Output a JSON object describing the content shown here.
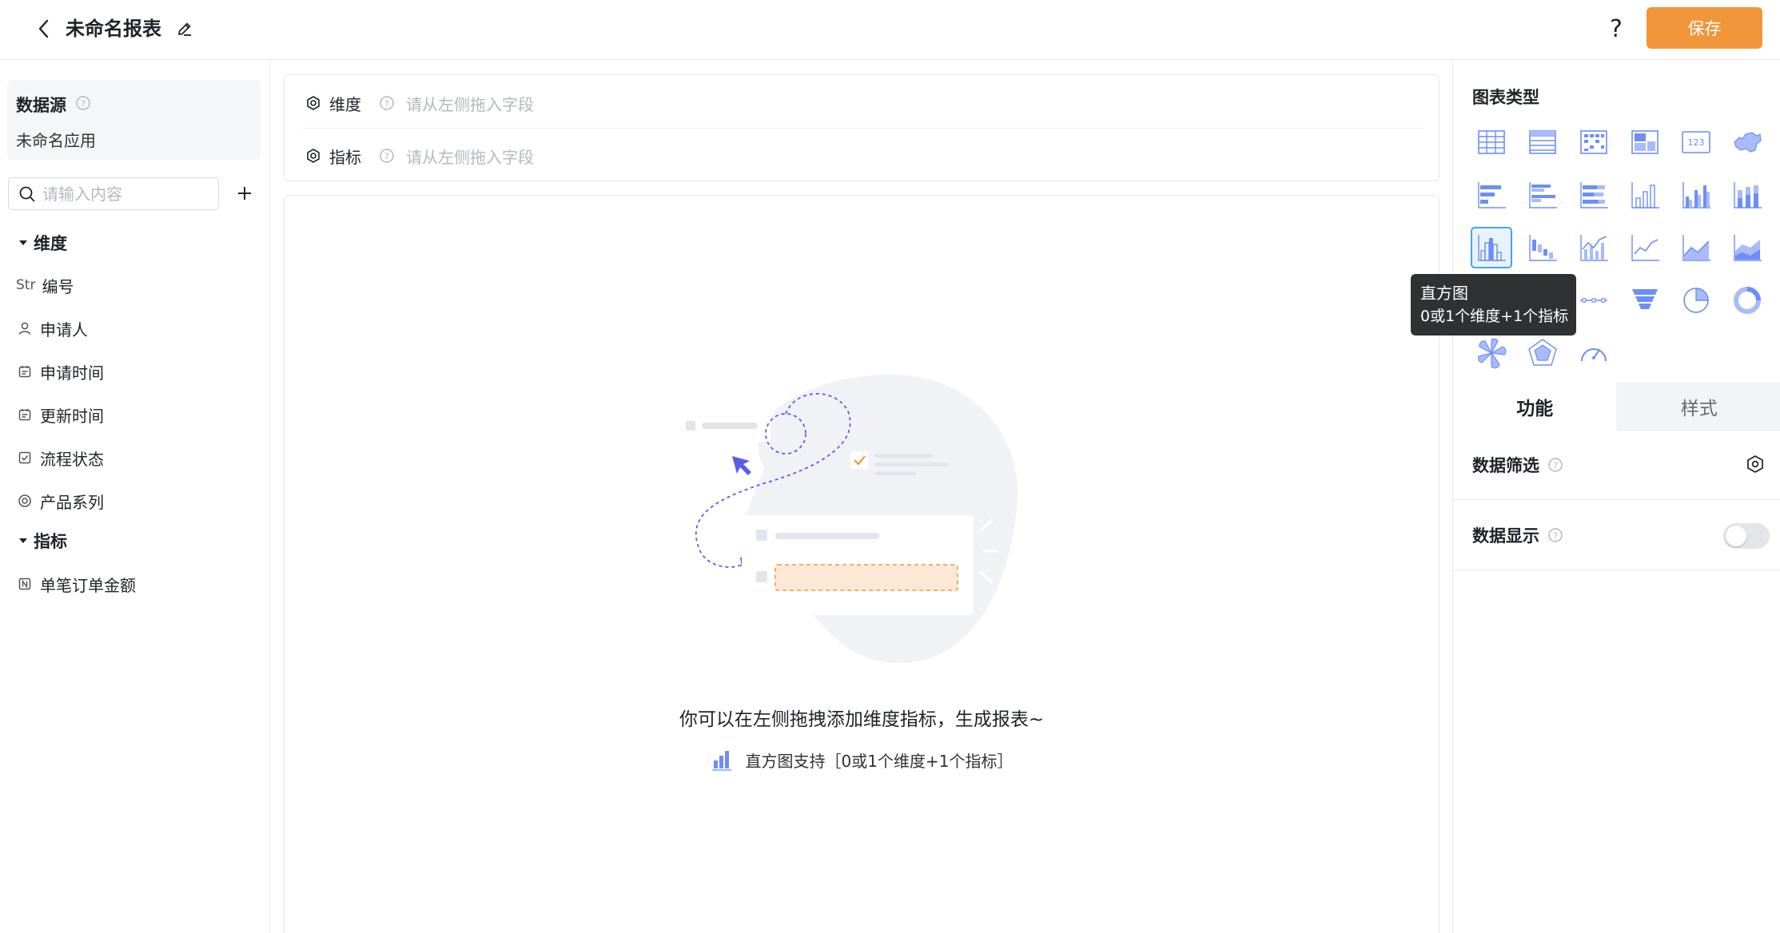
{
  "header": {
    "title": "未命名报表",
    "help": "?",
    "save_label": "保存"
  },
  "sidebar": {
    "datasource_title": "数据源",
    "datasource_app": "未命名应用",
    "search_placeholder": "请输入内容",
    "dimension_group": "维度",
    "dimensions": [
      {
        "type": "Str",
        "icon": "str-type-icon",
        "label": "编号"
      },
      {
        "type": "user",
        "icon": "user-icon",
        "label": "申请人"
      },
      {
        "type": "date",
        "icon": "calendar-icon",
        "label": "申请时间"
      },
      {
        "type": "date",
        "icon": "calendar-icon",
        "label": "更新时间"
      },
      {
        "type": "status",
        "icon": "checkbox-icon",
        "label": "流程状态"
      },
      {
        "type": "option",
        "icon": "radio-icon",
        "label": "产品系列"
      }
    ],
    "metric_group": "指标",
    "metrics": [
      {
        "type": "number",
        "icon": "number-icon",
        "label": "单笔订单金额"
      }
    ]
  },
  "dropzone": {
    "dimension_label": "维度",
    "dimension_placeholder": "请从左侧拖入字段",
    "metric_label": "指标",
    "metric_placeholder": "请从左侧拖入字段"
  },
  "canvas": {
    "empty_message": "你可以在左侧拖拽添加维度指标，生成报表~",
    "hint": "直方图支持［0或1个维度+1个指标］"
  },
  "right_panel": {
    "chart_type_title": "图表类型",
    "selected_chart": "histogram",
    "chart_types": [
      "table",
      "detail-table",
      "pivot-table",
      "grid-table",
      "indicator-card",
      "map",
      "bar-horizontal",
      "bar-horizontal-grouped",
      "bar-horizontal-stacked",
      "column",
      "column-grouped",
      "column-stacked",
      "histogram",
      "waterfall",
      "column-line",
      "line",
      "area",
      "area-stacked",
      "heatmap",
      "scatter",
      "timeline",
      "funnel",
      "pie",
      "donut",
      "rose",
      "radar",
      "gauge"
    ],
    "tabs": [
      {
        "label": "功能",
        "active": true
      },
      {
        "label": "样式",
        "active": false
      }
    ],
    "data_filter_label": "数据筛选",
    "data_display_label": "数据显示",
    "data_display_on": false,
    "accent_color": "#f0953a",
    "selected_color": "#42a5f5"
  },
  "tooltip": {
    "title": "直方图",
    "desc": "0或1个维度+1个指标"
  }
}
